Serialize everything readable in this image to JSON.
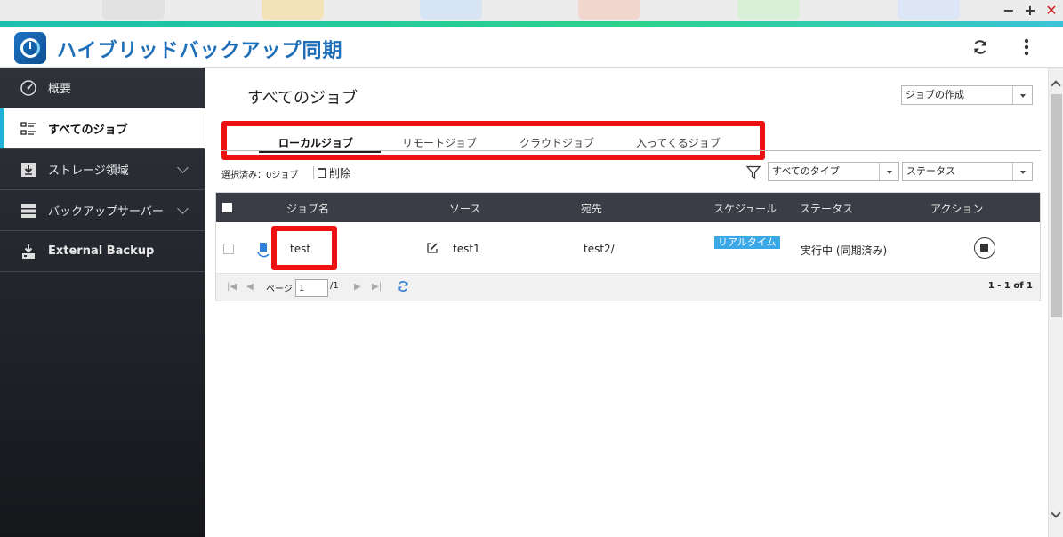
{
  "window": {
    "minimize": "−",
    "maximize": "+",
    "close": "✕"
  },
  "header": {
    "title": "ハイブリッドバックアップ同期",
    "logo_icon": "clock-sync-icon",
    "refresh_icon": "refresh-icon",
    "more_icon": "more-vertical-icon"
  },
  "sidebar": {
    "items": [
      {
        "label": "概要",
        "icon": "dashboard-icon",
        "active": false,
        "expandable": false
      },
      {
        "label": "すべてのジョブ",
        "icon": "job-list-icon",
        "active": true,
        "expandable": false
      },
      {
        "label": "ストレージ領域",
        "icon": "storage-download-icon",
        "active": false,
        "expandable": true
      },
      {
        "label": "バックアップサーバー",
        "icon": "server-icon",
        "active": false,
        "expandable": true
      },
      {
        "label": "External Backup",
        "icon": "external-drive-icon",
        "active": false,
        "expandable": false
      }
    ]
  },
  "main": {
    "page_title": "すべてのジョブ",
    "create_job": "ジョブの作成",
    "tabs": [
      {
        "label": "ローカルジョブ",
        "active": true
      },
      {
        "label": "リモートジョブ",
        "active": false
      },
      {
        "label": "クラウドジョブ",
        "active": false
      },
      {
        "label": "入ってくるジョブ",
        "active": false
      }
    ],
    "selected_count": "選択済み：0ジョブ",
    "delete_label": "削除",
    "type_filter": "すべてのタイプ",
    "status_filter": "ステータス",
    "table": {
      "columns": [
        "ジョブ名",
        "ソース",
        "宛先",
        "スケジュール",
        "ステータス",
        "アクション"
      ],
      "rows": [
        {
          "name": "test",
          "source": "test1",
          "destination": "test2/",
          "schedule": "リアルタイム",
          "status": "実行中 (同期済み)",
          "action": "stop"
        }
      ]
    },
    "pager": {
      "page_label": "ページ",
      "page_value": "1",
      "page_total": "/1",
      "range": "1 - 1 of 1"
    }
  },
  "colors": {
    "accent_bar": "#2bd28c",
    "title_blue": "#1f6fb8",
    "highlight_red": "#ee1111",
    "badge_blue": "#3aa7e6",
    "table_header": "#3a3d45"
  }
}
